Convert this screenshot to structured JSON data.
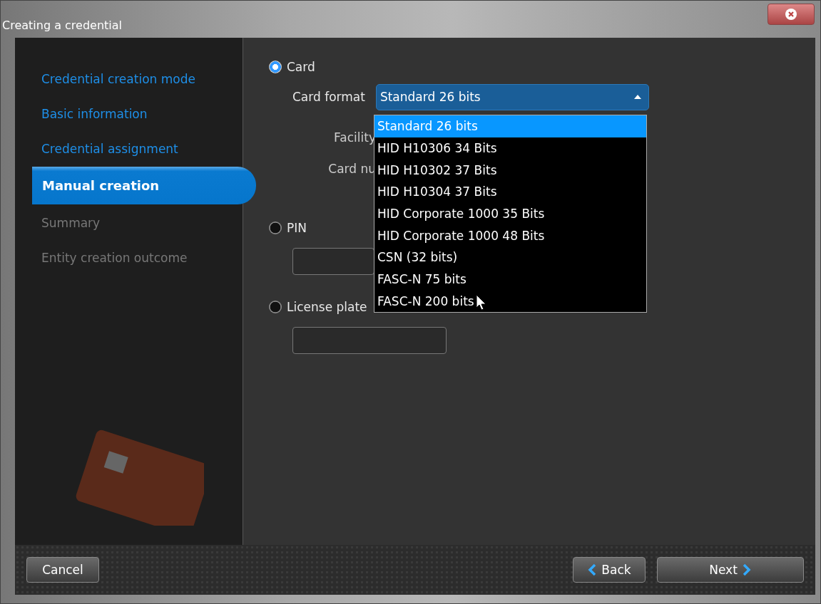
{
  "window": {
    "title": "Creating a credential"
  },
  "steps": [
    {
      "label": "Credential creation mode",
      "selected": false,
      "completed": true
    },
    {
      "label": "Basic information",
      "selected": false,
      "completed": true
    },
    {
      "label": "Credential assignment",
      "selected": false,
      "completed": true
    },
    {
      "label": "Manual creation",
      "selected": true,
      "completed": false
    },
    {
      "label": "Summary",
      "selected": false,
      "completed": false
    },
    {
      "label": "Entity creation outcome",
      "selected": false,
      "completed": false
    }
  ],
  "card": {
    "label": "Card",
    "selected": true,
    "format_label": "Card format",
    "format_value": "Standard 26 bits",
    "expanded": true,
    "format_options": [
      {
        "label": "Standard 26 bits",
        "selected": true
      },
      {
        "label": "HID H10306 34 Bits",
        "selected": false
      },
      {
        "label": "HID H10302 37 Bits",
        "selected": false
      },
      {
        "label": "HID H10304 37 Bits",
        "selected": false
      },
      {
        "label": "HID Corporate 1000 35 Bits",
        "selected": false
      },
      {
        "label": "HID Corporate 1000 48 Bits",
        "selected": false
      },
      {
        "label": "CSN (32 bits)",
        "selected": false
      },
      {
        "label": "FASC-N 75 bits",
        "selected": false
      },
      {
        "label": "FASC-N 200 bits",
        "selected": false
      }
    ],
    "fields": [
      "Facility",
      "Card nu"
    ]
  },
  "pin": {
    "label": "PIN",
    "selected": false
  },
  "license_plate": {
    "label": "License plate",
    "selected": false
  },
  "buttons": {
    "cancel": "Cancel",
    "back": "Back",
    "next": "Next"
  }
}
